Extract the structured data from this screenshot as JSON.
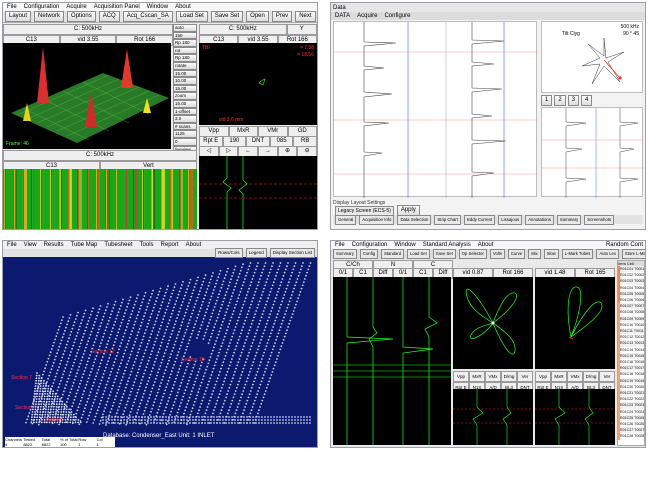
{
  "q1": {
    "menu": [
      "File",
      "Configuration",
      "Acquire",
      "Acquisition Panel",
      "Window",
      "About"
    ],
    "toolbar": [
      "Layout",
      "Network",
      "Options",
      "ACQ",
      "Acq_Cscan_SA",
      "Load Set",
      "Save Set",
      "Open",
      "Prev",
      "Next",
      "H Null",
      "Adj Tech"
    ],
    "c3d_header": {
      "freq": "C: 500kHz",
      "left": "C13",
      "mid": "vid 3.55",
      "right": "Rot 166"
    },
    "c3d_footer": "Frame: 46",
    "side_controls": [
      "auto",
      "150",
      "Rp 180",
      "rot",
      "Rp 180",
      "rotate",
      "15.00",
      "10.00",
      "15.00",
      "zoom",
      "15.00",
      "1-offset",
      "3.0",
      "# scans",
      "1125",
      "0",
      "liveview",
      "thresh",
      "adj.IM",
      "adj.dna",
      "cal rate"
    ],
    "cscan_header": {
      "freq": "C: 500kHz",
      "left": "C13",
      "right": "Vert"
    },
    "lis_header": {
      "freq": "C: 500kHz",
      "y": "Y",
      "left": "C13",
      "mid": "vid 3.55",
      "right": "Rot 166"
    },
    "lis_red_label": "TBI",
    "lis_value_right": "= 7.38",
    "lis_value_right2": "= 18.56",
    "lis_bottom_value": "vid 3.6 mm",
    "meas_row1": [
      "Vpp",
      "MxR",
      "VMr",
      "GD"
    ],
    "meas_row2": [
      "Rpt E",
      "190",
      "DNT",
      "085",
      "RB"
    ],
    "icons_row": [
      "◁",
      "▷",
      "←",
      "→",
      "⊕",
      "⊖"
    ]
  },
  "q2": {
    "title_left": "Data",
    "status_row": [
      "DATA",
      "Acquire",
      "Configure"
    ],
    "tabs": [
      "General",
      "Acquisition Info",
      "Data Selection",
      "Strip Chart",
      "Eddy Current",
      "Lissajous",
      "Annotations",
      "Summary",
      "Screenshots"
    ],
    "footer_label": "Display Layout Settings",
    "footer_select": "Legacy Screen (ECS-5)",
    "footer_btn": "Apply",
    "right_btns": [
      "1",
      "2",
      "3",
      "4"
    ],
    "right_label1": "500 kHz",
    "right_label2": "Tilt Clyg",
    "right_label3": "90 ° 45"
  },
  "q3": {
    "menu": [
      "File",
      "View",
      "Results",
      "Tube Map",
      "Tubesheet",
      "Tools",
      "Report",
      "About"
    ],
    "toolbar_right": [
      "Rows/Cols",
      "Legend",
      "Display Section List"
    ],
    "regions": [
      "Section 12",
      "Section 10",
      "Section 7",
      "Section 4",
      "Section 3"
    ],
    "footer": "Database: Condenser_East Unit: 1 INLET",
    "bottom_labels": [
      "Channels",
      "Tested",
      "Total",
      "% of Total",
      "Row",
      "Col"
    ],
    "bottom_values": [
      "4 Channels",
      "8822",
      "8822",
      "100",
      "1",
      "1"
    ]
  },
  "q4": {
    "menu": [
      "File",
      "Configuration",
      "Window",
      "Standard Analysis",
      "About"
    ],
    "top_right": "Random Cont",
    "tabs": [
      "Summary",
      "Config",
      "Standard",
      "Load Set",
      "Save Set",
      "Op Selector",
      "Volts",
      "Curve",
      "Mix",
      "Slow",
      "L-Mark Tubes",
      "Auto Lex",
      "Store L-Mark",
      "Alter Scale"
    ],
    "ch_header": [
      "C/Ch",
      "N",
      "C"
    ],
    "ch_header2": [
      "0/1",
      "C1",
      "Diff",
      "0/1",
      "C1",
      "Diff"
    ],
    "liss_info1": "vid 0.87",
    "liss_info1b": "Rot 166",
    "liss_info2": "vid 1.48",
    "liss_info2b": "Rot 165",
    "meas1": [
      "Vpp",
      "MxR",
      "VMx",
      "D/mg",
      "Ver"
    ],
    "meas1b": [
      "Rpt E",
      "N1X",
      "A/D",
      "BL3",
      "DNT"
    ],
    "meas2": [
      "Vpp",
      "MxR",
      "VMx",
      "D/mg",
      "Ver"
    ],
    "meas2b": [
      "Rpt E",
      "N1X",
      "A/D",
      "BL3",
      "DNT"
    ],
    "tube_list_header": "Item Cell",
    "tube_list": [
      "R01C01 T0001",
      "R01C02 T0002",
      "R01C03 T0003",
      "R01C04 T0004",
      "R01C05 T0005",
      "R01C06 T0006",
      "R01C07 T0007",
      "R01C08 T0008",
      "R01C09 T0009",
      "R01C10 T0010",
      "R01C11 T0011",
      "R01C12 T0012",
      "R01C13 T0013",
      "R01C14 T0014",
      "R01C15 T0015",
      "R01C16 T0016",
      "R01C17 T0017",
      "R01C18 T0018",
      "R01C19 T0019",
      "R01C20 T0020",
      "R01C21 T0021",
      "R01C22 T0022",
      "R01C23 T0023",
      "R01C24 T0024",
      "R01C25 T0025",
      "R01C26 T0026",
      "R01C27 T0027",
      "R01C28 T0028"
    ]
  },
  "colors": {
    "accent_red": "#ff2020",
    "trace_green": "#22ff22",
    "tubesheet_blue": "#1c2f8a",
    "panel_bg": "#f0f0f0"
  }
}
